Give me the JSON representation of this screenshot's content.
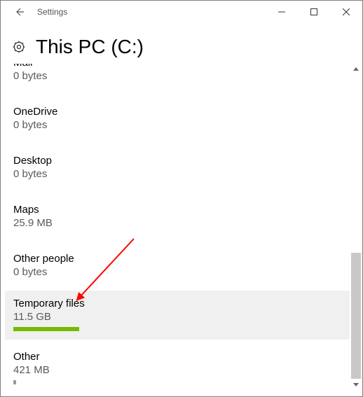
{
  "titlebar": {
    "title": "Settings"
  },
  "page": {
    "title": "This PC (C:)"
  },
  "storage": {
    "items": [
      {
        "name": "Mail",
        "size": "0 bytes",
        "cutTop": true
      },
      {
        "name": "OneDrive",
        "size": "0 bytes"
      },
      {
        "name": "Desktop",
        "size": "0 bytes"
      },
      {
        "name": "Maps",
        "size": "25.9 MB"
      },
      {
        "name": "Other people",
        "size": "0 bytes"
      },
      {
        "name": "Temporary files",
        "size": "11.5 GB",
        "selected": true,
        "barPercent": 20
      },
      {
        "name": "Other",
        "size": "421 MB",
        "tinyBar": true
      }
    ]
  },
  "arrow": {
    "color": "#ff0000"
  }
}
